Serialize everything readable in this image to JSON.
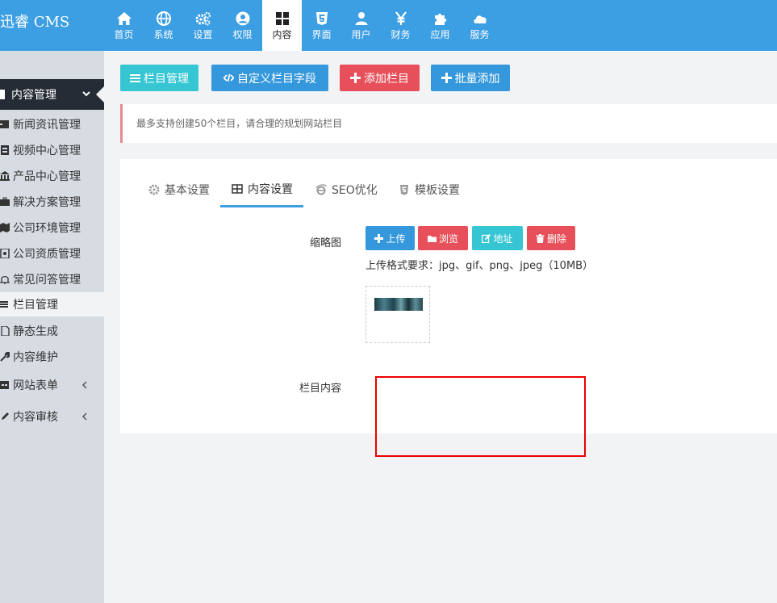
{
  "app": {
    "logo": "迅睿 CMS"
  },
  "topnav": [
    {
      "label": "首页",
      "icon": "home-icon"
    },
    {
      "label": "系统",
      "icon": "globe-icon"
    },
    {
      "label": "设置",
      "icon": "cogs-icon"
    },
    {
      "label": "权限",
      "icon": "user-circle-icon"
    },
    {
      "label": "内容",
      "icon": "grid-icon",
      "active": true
    },
    {
      "label": "界面",
      "icon": "html5-icon"
    },
    {
      "label": "用户",
      "icon": "user-icon"
    },
    {
      "label": "财务",
      "icon": "yen-icon"
    },
    {
      "label": "应用",
      "icon": "puzzle-icon"
    },
    {
      "label": "服务",
      "icon": "cloud-icon"
    }
  ],
  "sidebar": {
    "header": "内容管理",
    "items": [
      {
        "label": "新闻资讯管理",
        "icon": "newspaper-icon"
      },
      {
        "label": "视频中心管理",
        "icon": "video-icon"
      },
      {
        "label": "产品中心管理",
        "icon": "bank-icon"
      },
      {
        "label": "解决方案管理",
        "icon": "briefcase-icon"
      },
      {
        "label": "公司环境管理",
        "icon": "map-icon"
      },
      {
        "label": "公司资质管理",
        "icon": "certificate-icon"
      },
      {
        "label": "常见问答管理",
        "icon": "bell-icon"
      },
      {
        "label": "栏目管理",
        "icon": "list-icon",
        "active": true
      },
      {
        "label": "静态生成",
        "icon": "file-icon"
      },
      {
        "label": "内容维护",
        "icon": "wrench-icon"
      },
      {
        "label": "网站表单",
        "icon": "table-icon",
        "submenu": true
      },
      {
        "label": "内容审核",
        "icon": "edit-icon",
        "submenu": true
      }
    ]
  },
  "toolbar": {
    "column_manage": "栏目管理",
    "custom_fields": "自定义栏目字段",
    "add_column": "添加栏目",
    "batch_add": "批量添加"
  },
  "tip": "最多支持创建50个栏目，请合理的规划网站栏目",
  "tabs": [
    {
      "label": "基本设置",
      "icon": "cog-icon"
    },
    {
      "label": "内容设置",
      "icon": "table-icon",
      "active": true
    },
    {
      "label": "SEO优化",
      "icon": "ie-icon"
    },
    {
      "label": "模板设置",
      "icon": "html5-icon"
    }
  ],
  "form": {
    "thumb_label": "缩略图",
    "upload": "上传",
    "browse": "浏览",
    "address": "地址",
    "delete": "删除",
    "upload_note": "上传格式要求：jpg、gif、png、jpeg（10MB）",
    "content_label": "栏目内容"
  },
  "colors": {
    "topbar": "#3c9ee3",
    "teal": "#36c6d3",
    "blue": "#3598dc",
    "red": "#e7505a",
    "sidebar_dark": "#262c36"
  }
}
